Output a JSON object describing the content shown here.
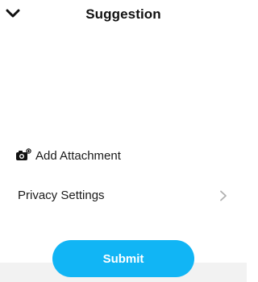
{
  "header": {
    "back_icon": "chevron-down-icon",
    "title": "Suggestion"
  },
  "attachment": {
    "icon": "camera-add-icon",
    "label": "Add Attachment"
  },
  "privacy": {
    "label": "Privacy Settings",
    "icon": "chevron-right-icon"
  },
  "submit": {
    "label": "Submit"
  },
  "colors": {
    "accent": "#11b5f5",
    "chevron": "#b0b0b0",
    "text": "#1a1a1a"
  }
}
